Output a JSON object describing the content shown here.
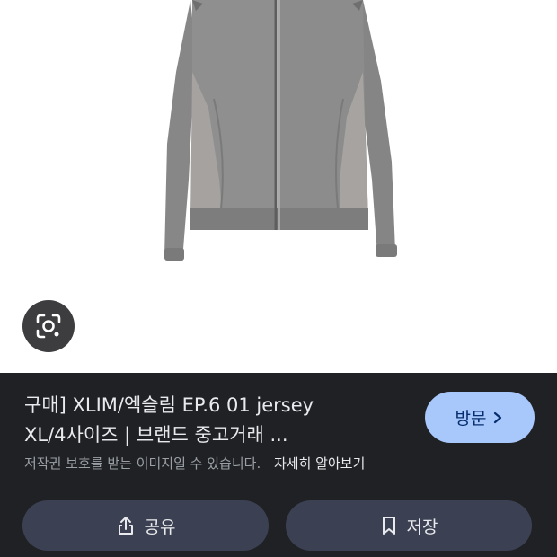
{
  "product": {
    "title": "구매] XLIM/엑슬림 EP.6 01 jersey XL/4사이즈 | 브랜드 중고거래 ..."
  },
  "visit_button": {
    "label": "방문"
  },
  "copyright": {
    "notice": "저작권 보호를 받는 이미지일 수 있습니다.",
    "learn_more": "자세히 알아보기"
  },
  "actions": {
    "share_label": "공유",
    "save_label": "저장"
  },
  "colors": {
    "panel_background": "#202124",
    "visit_button": "#a8c7fa",
    "action_button": "#3b4152",
    "jacket": "#8b8b8b"
  },
  "icons": {
    "lens": "google-lens-icon",
    "visit": "chevron-right-icon",
    "share": "share-icon",
    "save": "bookmark-icon"
  }
}
